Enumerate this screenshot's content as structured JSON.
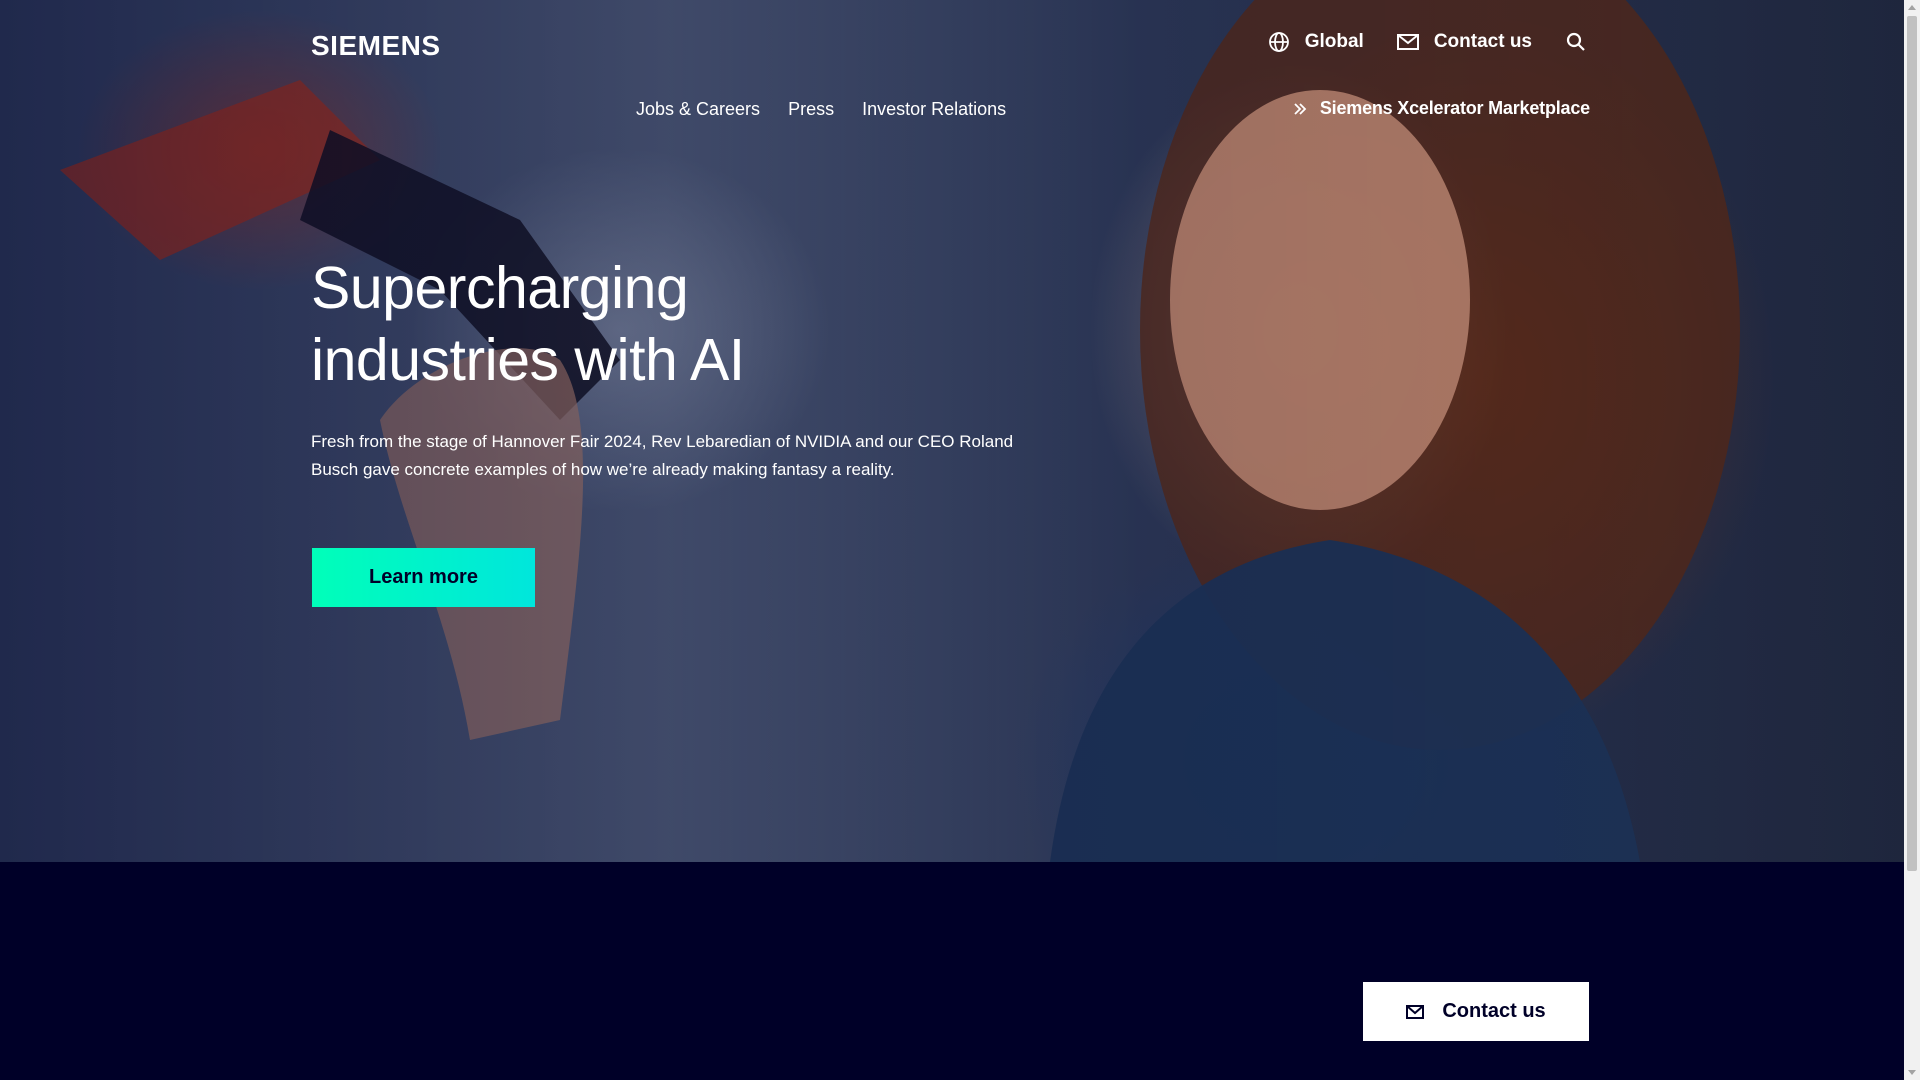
{
  "header": {
    "logo": "SIEMENS",
    "global_label": "Global",
    "contact_label": "Contact us",
    "nav": [
      {
        "label": "Jobs & Careers"
      },
      {
        "label": "Press"
      },
      {
        "label": "Investor Relations"
      }
    ],
    "marketplace_label": "Siemens Xcelerator Marketplace"
  },
  "hero": {
    "headline": "Supercharging industries with AI",
    "subtext": "Fresh from the stage of Hannover Fair 2024, Rev Lebaredian of NVIDIA and our CEO Roland Busch gave concrete examples of how we’re already making fantasy a reality.",
    "cta_label": "Learn more"
  },
  "band": {
    "contact_button_label": "Contact us"
  },
  "colors": {
    "brand_dark": "#000028",
    "cta_start": "#00ffb9",
    "cta_end": "#00e6dc"
  },
  "icons": [
    "globe-icon",
    "mail-icon",
    "search-icon",
    "double-chevron-right-icon"
  ]
}
